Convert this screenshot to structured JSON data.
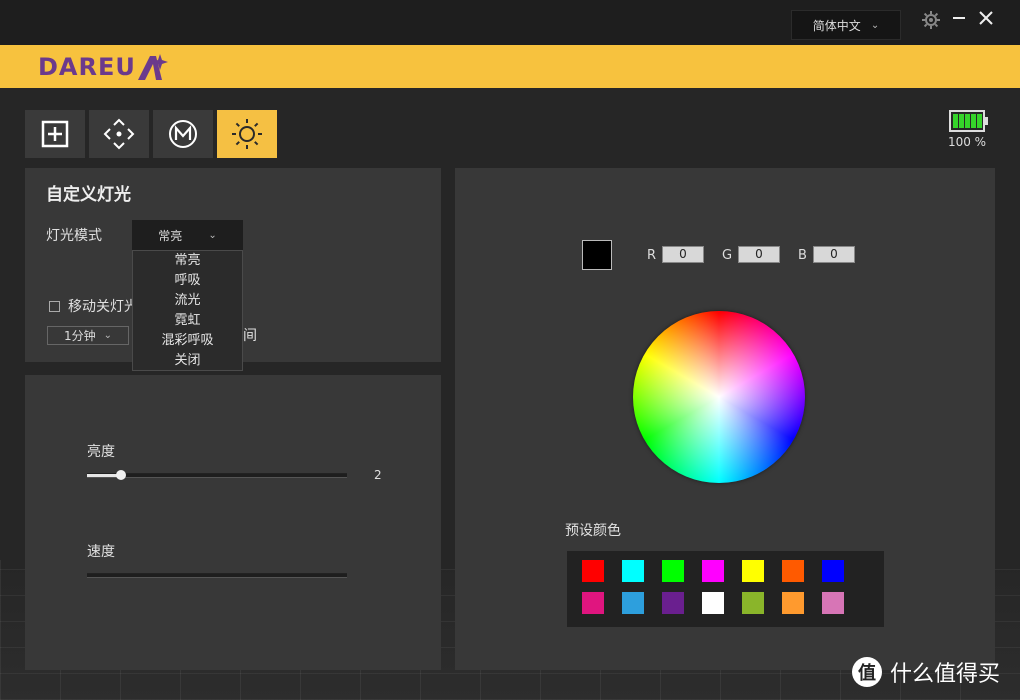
{
  "titlebar": {
    "language": "简体中文"
  },
  "brand": {
    "logo_text": "DAREU",
    "banner_color": "#f7c23e",
    "logo_color": "#6b3a8c"
  },
  "toolbar": {
    "icons": [
      "add-square-icon",
      "move-arrows-icon",
      "macro-m-icon",
      "brightness-sun-icon"
    ],
    "active_index": 3
  },
  "battery": {
    "label": "100 %",
    "level": 1.0,
    "color": "#35d42a"
  },
  "custom_light": {
    "title": "自定义灯光",
    "mode_label": "灯光模式",
    "mode_selected": "常亮",
    "mode_options": [
      "常亮",
      "呼吸",
      "流光",
      "霓虹",
      "混彩呼吸",
      "关闭"
    ],
    "move_off_label": "移动关灯光",
    "time_value": "1分钟",
    "time_suffix": "间"
  },
  "sliders": {
    "brightness_label": "亮度",
    "brightness_value": "2",
    "brightness_level": 0.13,
    "speed_label": "速度"
  },
  "color": {
    "r_label": "R",
    "r_value": "0",
    "g_label": "G",
    "g_value": "0",
    "b_label": "B",
    "b_value": "0",
    "current": "#000000",
    "preset_label": "预设颜色",
    "presets": [
      "#ff0000",
      "#00ffff",
      "#00ff00",
      "#ff00ff",
      "#ffff00",
      "#ff5a00",
      "#0000ff",
      "#e0157f",
      "#2d9fdd",
      "#6a1f8f",
      "#ffffff",
      "#8ab52a",
      "#ff9a2e",
      "#d775b6"
    ]
  },
  "watermark": {
    "badge": "值",
    "text": "什么值得买"
  }
}
